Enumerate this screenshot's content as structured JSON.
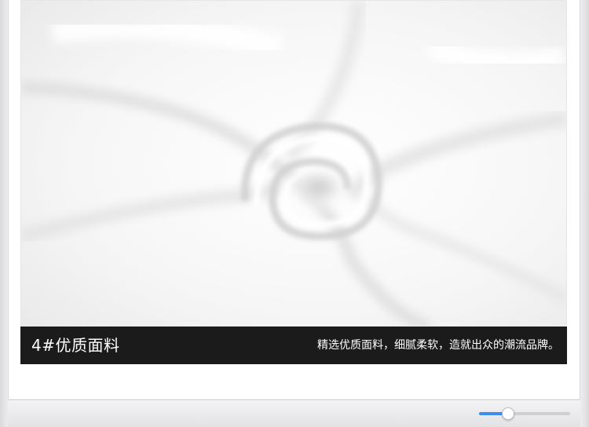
{
  "feature": {
    "title": "4#优质面料",
    "description": "精选优质面料，细腻柔软，造就出众的潮流品牌。"
  },
  "photo": {
    "subject": "white-fabric-swirl"
  },
  "slider": {
    "value_fraction": 0.32,
    "accent_color": "#3b8ef0"
  }
}
